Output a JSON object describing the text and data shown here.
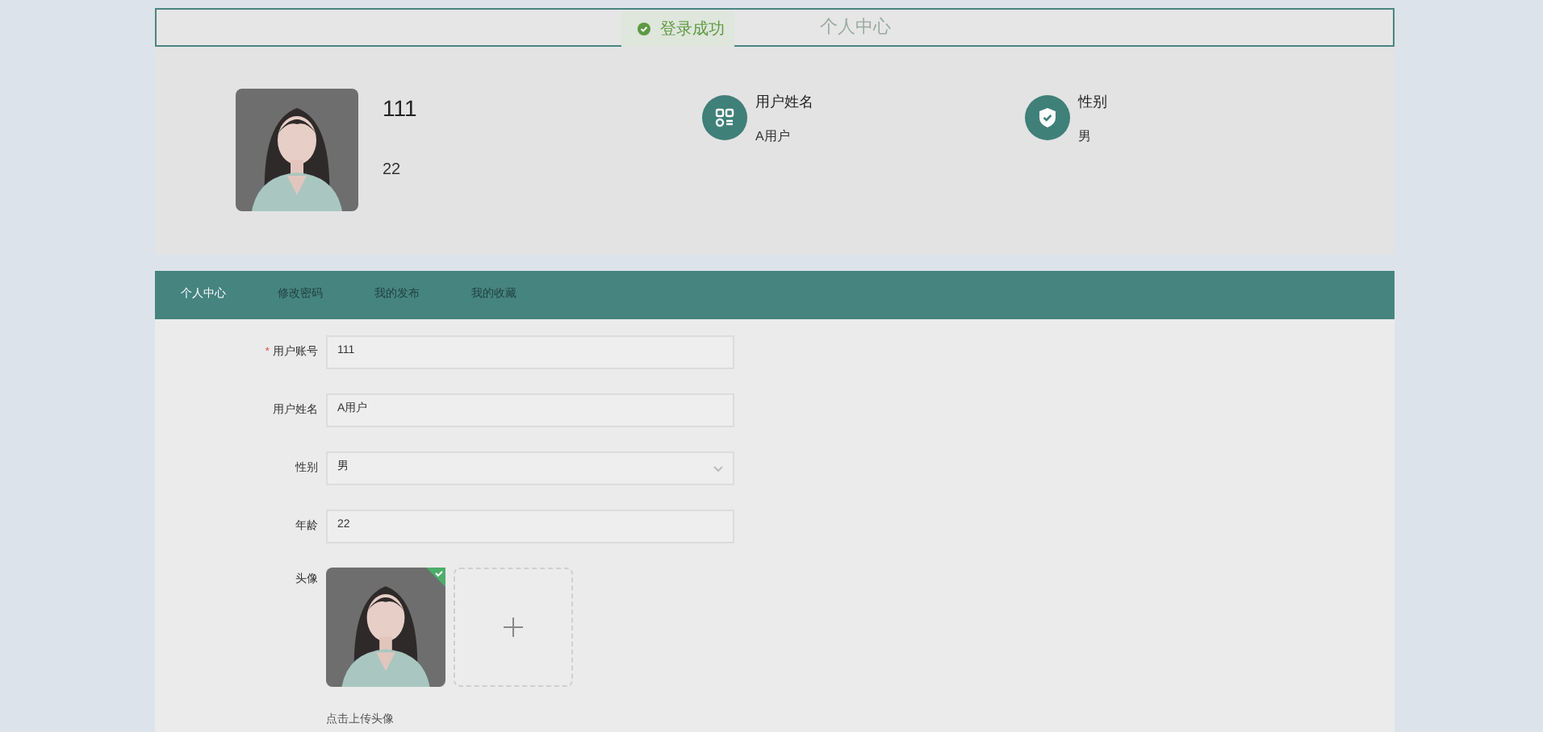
{
  "header": {
    "title": "个人中心"
  },
  "toast": {
    "message": "登录成功"
  },
  "profile": {
    "account": "111",
    "age": "22",
    "stats": [
      {
        "kind": "apps",
        "label": "用户姓名",
        "value": "A用户"
      },
      {
        "kind": "shield",
        "label": "性别",
        "value": "男"
      }
    ]
  },
  "tabs": [
    {
      "label": "个人中心",
      "selected": true
    },
    {
      "label": "修改密码",
      "selected": false
    },
    {
      "label": "我的发布",
      "selected": false
    },
    {
      "label": "我的收藏",
      "selected": false
    }
  ],
  "form": {
    "fields": [
      {
        "kind": "text",
        "label": "用户账号",
        "required_mark": "*",
        "value": "111"
      },
      {
        "kind": "text",
        "label": "用户姓名",
        "value": "A用户"
      },
      {
        "kind": "select",
        "label": "性别",
        "value": "男"
      },
      {
        "kind": "text",
        "label": "年龄",
        "value": "22"
      },
      {
        "kind": "upload",
        "label": "头像",
        "uploaded": true,
        "hint": "点击上传头像"
      }
    ]
  }
}
